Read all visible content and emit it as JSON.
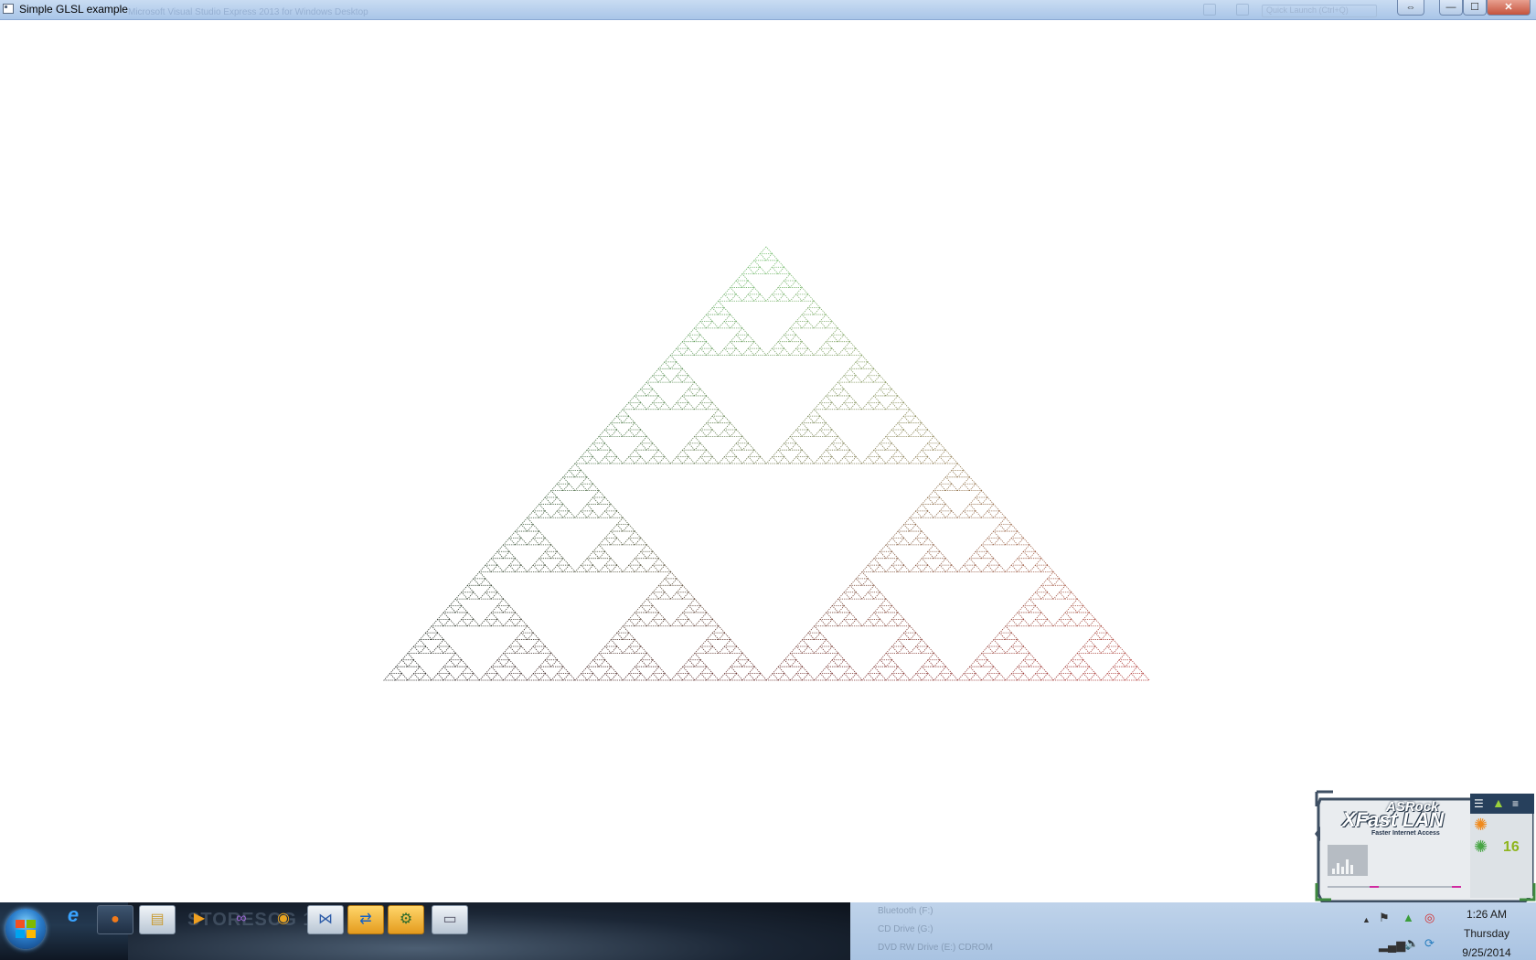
{
  "window": {
    "title": "Simple GLSL example",
    "ghost_title": "Microsoft Visual Studio Express 2013 for Windows Desktop",
    "ghost_search": "Quick Launch (Ctrl+Q)",
    "buttons": {
      "minimize": "—",
      "maximize": "☐",
      "close": "✕",
      "restore": "⇔"
    }
  },
  "canvas": {
    "description": "sierpinski-triangle-render",
    "colors": {
      "top": "#6fbf6a",
      "left": "#1a1a1a",
      "right": "#b0302e"
    }
  },
  "widget": {
    "brand": "ASRock",
    "product": "XFast LAN",
    "tagline": "Faster Internet Access",
    "counter": "16",
    "accent": "#9ad13b"
  },
  "taskbar": {
    "ghost_text": "STORESCG 104",
    "apps": [
      {
        "name": "internet-explorer",
        "glyph": "e"
      },
      {
        "name": "firefox",
        "glyph": "●"
      },
      {
        "name": "file-explorer",
        "glyph": "▤"
      },
      {
        "name": "media-player",
        "glyph": "▶"
      },
      {
        "name": "visual-studio-express",
        "glyph": "∞"
      },
      {
        "name": "chrome",
        "glyph": "◉"
      },
      {
        "name": "visual-studio",
        "glyph": "⋈"
      },
      {
        "name": "teamviewer",
        "glyph": "⇄"
      },
      {
        "name": "network-tool",
        "glyph": "⚙"
      },
      {
        "name": "glsl-window",
        "glyph": "▭"
      }
    ],
    "drives_ghost": [
      "Bluetooth (F:)",
      "CD Drive (G:)",
      "DVD RW Drive (E:) CDROM"
    ],
    "tray": {
      "show_hidden": "▲",
      "icons": [
        "action-center-flag",
        "google-drive",
        "opera",
        "network",
        "volume",
        "update"
      ]
    },
    "clock": {
      "time": "1:26 AM",
      "day": "Thursday",
      "date": "9/25/2014"
    }
  }
}
